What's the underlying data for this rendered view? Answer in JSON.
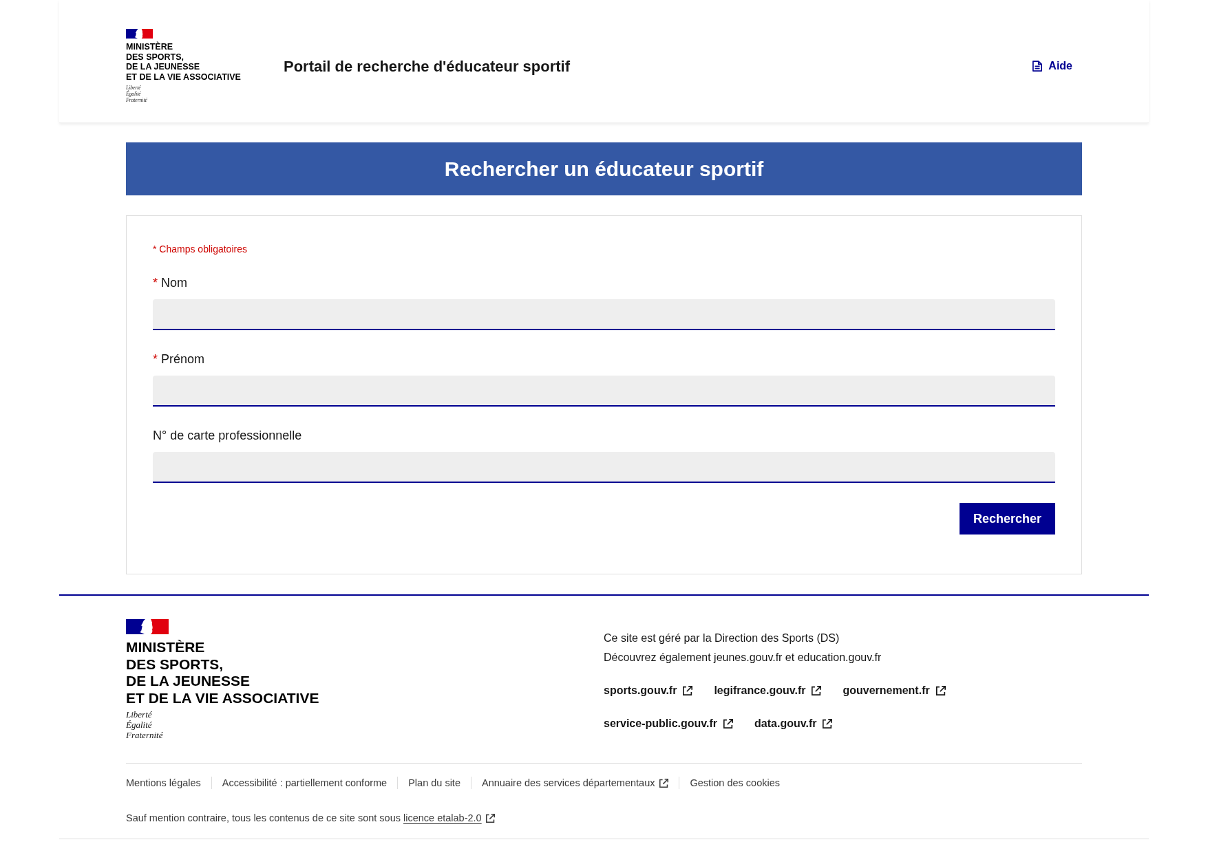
{
  "header": {
    "ministry_name": [
      "MINISTÈRE",
      "DES SPORTS,",
      "DE LA JEUNESSE",
      "ET DE LA VIE ASSOCIATIVE"
    ],
    "motto": [
      "Liberté",
      "Égalité",
      "Fraternité"
    ],
    "title": "Portail de recherche d'éducateur sportif",
    "help_link": "Aide"
  },
  "banner": {
    "title": "Rechercher un éducateur sportif"
  },
  "form": {
    "required_note": "* Champs obligatoires",
    "fields": [
      {
        "label": "Nom",
        "required_mark": "*"
      },
      {
        "label": "Prénom",
        "required_mark": "*"
      },
      {
        "label": "N° de carte professionnelle"
      }
    ],
    "submit_button": "Rechercher"
  },
  "footer": {
    "ministry_name": [
      "MINISTÈRE",
      "DES SPORTS,",
      "DE LA JEUNESSE",
      "ET DE LA VIE ASSOCIATIVE"
    ],
    "motto": [
      "Liberté",
      "Égalité",
      "Fraternité"
    ],
    "description": [
      "Ce site est géré par la Direction des Sports (DS)",
      "Découvrez également jeunes.gouv.fr et education.gouv.fr"
    ],
    "links": [
      {
        "label": "sports.gouv.fr",
        "external": true
      },
      {
        "label": "legifrance.gouv.fr",
        "external": true
      },
      {
        "label": "gouvernement.fr",
        "external": true
      },
      {
        "label": "service-public.gouv.fr",
        "external": true
      },
      {
        "label": "data.gouv.fr",
        "external": true
      }
    ],
    "bottom_links": [
      {
        "label": "Mentions légales",
        "external": false
      },
      {
        "label": "Accessibilité : partiellement conforme",
        "external": false
      },
      {
        "label": "Plan du site",
        "external": false
      },
      {
        "label": "Annuaire des services départementaux",
        "external": true
      },
      {
        "label": "Gestion des cookies",
        "external": false
      }
    ],
    "license": {
      "text": "Sauf mention contraire, tous les contenus de ce site sont sous",
      "link": {
        "label": "licence etalab-2.0",
        "external": true
      }
    }
  }
}
